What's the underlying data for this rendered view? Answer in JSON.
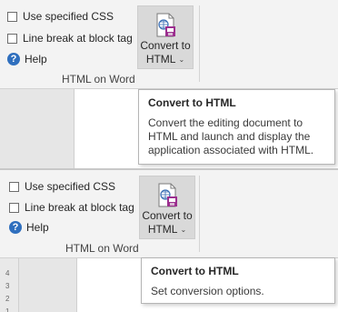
{
  "panels": [
    {
      "group": {
        "checkbox_css_label": "Use specified CSS",
        "checkbox_linebreak_label": "Line break at block tag",
        "help_label": "Help",
        "group_name": "HTML on Word",
        "convert_button": {
          "line1": "Convert to",
          "line2": "HTML"
        }
      },
      "tooltip": {
        "title": "Convert to HTML",
        "text": "Convert the editing document to HTML and launch and display the application associated with HTML."
      }
    },
    {
      "group": {
        "checkbox_css_label": "Use specified CSS",
        "checkbox_linebreak_label": "Line break at block tag",
        "help_label": "Help",
        "group_name": "HTML on Word",
        "convert_button": {
          "line1": "Convert to",
          "line2": "HTML"
        }
      },
      "tooltip": {
        "title": "Convert to HTML",
        "text": "Set conversion options."
      },
      "ruler_numbers": [
        "4",
        "3",
        "2",
        "1"
      ]
    }
  ],
  "colors": {
    "help_icon": "#2f6fbe",
    "button_pressed": "#d9d9d9",
    "icon_accent": "#9c2f8f"
  }
}
